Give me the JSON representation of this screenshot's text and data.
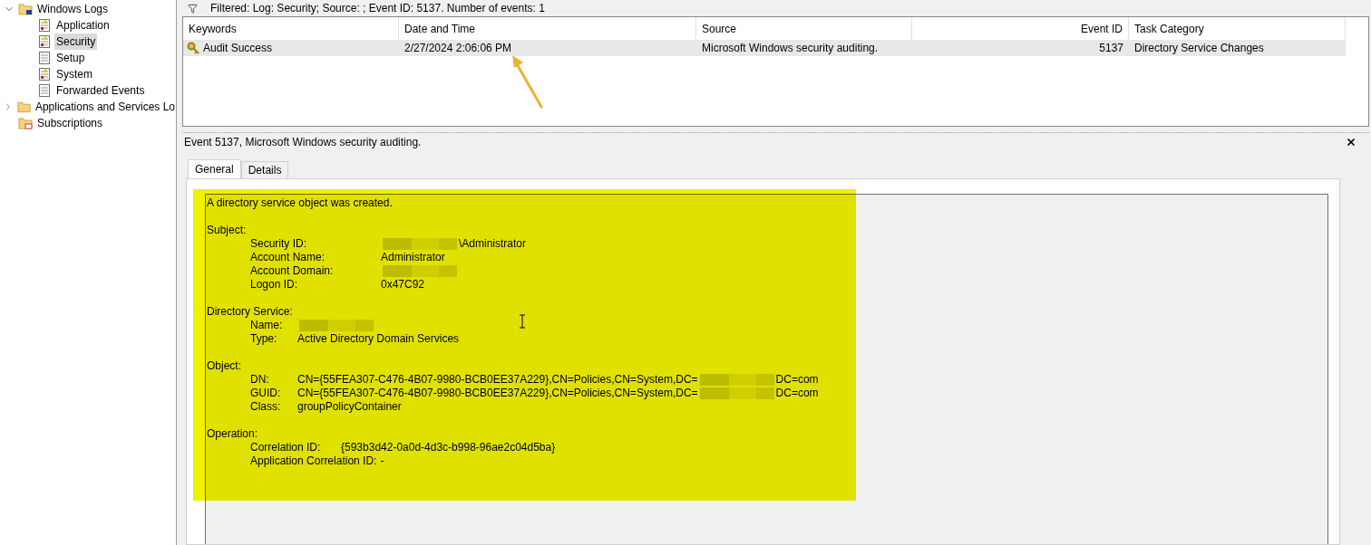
{
  "tree": [
    {
      "label": "Windows Logs",
      "kind": "logfolder",
      "expanded": true,
      "selected": false,
      "children": [
        {
          "label": "Application",
          "kind": "alertlog",
          "selected": false
        },
        {
          "label": "Security",
          "kind": "alertlog",
          "selected": true
        },
        {
          "label": "Setup",
          "kind": "log",
          "selected": false
        },
        {
          "label": "System",
          "kind": "alertlog",
          "selected": false
        },
        {
          "label": "Forwarded Events",
          "kind": "log",
          "selected": false
        }
      ]
    },
    {
      "label": "Applications and Services Lo",
      "kind": "folder",
      "expanded": false,
      "selected": false
    },
    {
      "label": "Subscriptions",
      "kind": "subscriptions",
      "selected": false
    }
  ],
  "filter_text": "Filtered: Log: Security; Source: ; Event ID: 5137. Number of events: 1",
  "events": {
    "columns": [
      {
        "label": "Keywords"
      },
      {
        "label": "Date and Time"
      },
      {
        "label": "Source"
      },
      {
        "label": "Event ID"
      },
      {
        "label": "Task Category"
      }
    ],
    "rows": [
      {
        "selected": true,
        "cells": [
          "Audit Success",
          "2/27/2024 2:06:06 PM",
          "Microsoft Windows security auditing.",
          "5137",
          "Directory Service Changes"
        ]
      }
    ]
  },
  "detail": {
    "title": "Event 5137, Microsoft Windows security auditing.",
    "tabs": [
      {
        "label": "General",
        "selected": true
      },
      {
        "label": "Details",
        "selected": false
      }
    ],
    "summary": "A directory service object was created.",
    "sections": [
      {
        "kind": "subject",
        "heading": "Subject:",
        "fields": [
          {
            "label": "Security ID:",
            "parts": [
              {
                "kind": "redacted"
              },
              {
                "kind": "text",
                "text": "\\Administrator"
              }
            ]
          },
          {
            "label": "Account Name:",
            "parts": [
              {
                "kind": "text",
                "text": "Administrator"
              }
            ]
          },
          {
            "label": "Account Domain:",
            "parts": [
              {
                "kind": "redacted"
              }
            ]
          },
          {
            "label": "Logon ID:",
            "parts": [
              {
                "kind": "text",
                "text": "0x47C92"
              }
            ]
          }
        ]
      },
      {
        "kind": "service",
        "heading": "Directory Service:",
        "fields": [
          {
            "label": "Name:",
            "parts": [
              {
                "kind": "redacted"
              }
            ]
          },
          {
            "label": "Type:",
            "parts": [
              {
                "kind": "text",
                "text": "Active Directory Domain Services"
              }
            ]
          }
        ]
      },
      {
        "kind": "object",
        "heading": "Object:",
        "fields": [
          {
            "label": "DN:",
            "parts": [
              {
                "kind": "text",
                "text": "CN={55FEA307-C476-4B07-9980-BCB0EE37A229},CN=Policies,CN=System,DC="
              },
              {
                "kind": "redacted"
              },
              {
                "kind": "text",
                "text": "DC=com"
              }
            ]
          },
          {
            "label": "GUID:",
            "parts": [
              {
                "kind": "text",
                "text": "CN={55FEA307-C476-4B07-9980-BCB0EE37A229},CN=Policies,CN=System,DC="
              },
              {
                "kind": "redacted"
              },
              {
                "kind": "text",
                "text": "DC=com"
              }
            ]
          },
          {
            "label": "Class:",
            "parts": [
              {
                "kind": "text",
                "text": "groupPolicyContainer"
              }
            ]
          }
        ]
      },
      {
        "kind": "operation",
        "heading": "Operation:",
        "fields": [
          {
            "label": "Correlation ID:",
            "parts": [
              {
                "kind": "text",
                "text": "{593b3d42-0a0d-4d3c-b998-96ae2c04d5ba}"
              }
            ]
          },
          {
            "label": "Application Correlation ID:",
            "parts": [
              {
                "kind": "text",
                "text": "-"
              }
            ]
          }
        ]
      }
    ]
  },
  "annotations": {
    "highlight": true,
    "arrow": true
  }
}
